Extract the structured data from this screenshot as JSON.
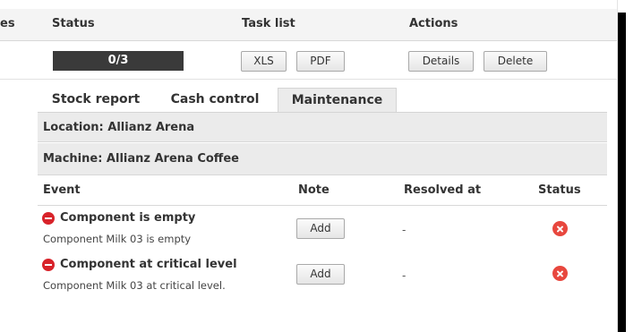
{
  "header": {
    "partial_label": "es",
    "status": "Status",
    "task_list": "Task list",
    "actions": "Actions"
  },
  "row": {
    "progress_text": "0/3",
    "progress_fraction": 0,
    "xls_label": "XLS",
    "pdf_label": "PDF",
    "details_label": "Details",
    "delete_label": "Delete"
  },
  "tabs": [
    {
      "label": "Stock report",
      "active": false
    },
    {
      "label": "Cash control",
      "active": false
    },
    {
      "label": "Maintenance",
      "active": true
    }
  ],
  "panel": {
    "location": "Location: Allianz Arena",
    "machine": "Machine: Allianz Arena Coffee",
    "columns": {
      "event": "Event",
      "note": "Note",
      "resolved": "Resolved at",
      "status": "Status"
    },
    "events": [
      {
        "title": "Component is empty",
        "description": "Component Milk 03 is empty",
        "note_button": "Add",
        "resolved_at": "-",
        "status_icon": "error-x-icon"
      },
      {
        "title": "Component at critical level",
        "description": "Component Milk 03 at critical level.",
        "note_button": "Add",
        "resolved_at": "-",
        "status_icon": "error-x-icon"
      }
    ]
  },
  "colors": {
    "progress_bg": "#3a3a3a",
    "header_bg": "#f4f4f4",
    "panel_bg": "#ebebeb",
    "error_red": "#e8473e",
    "minus_red": "#d8232a"
  }
}
